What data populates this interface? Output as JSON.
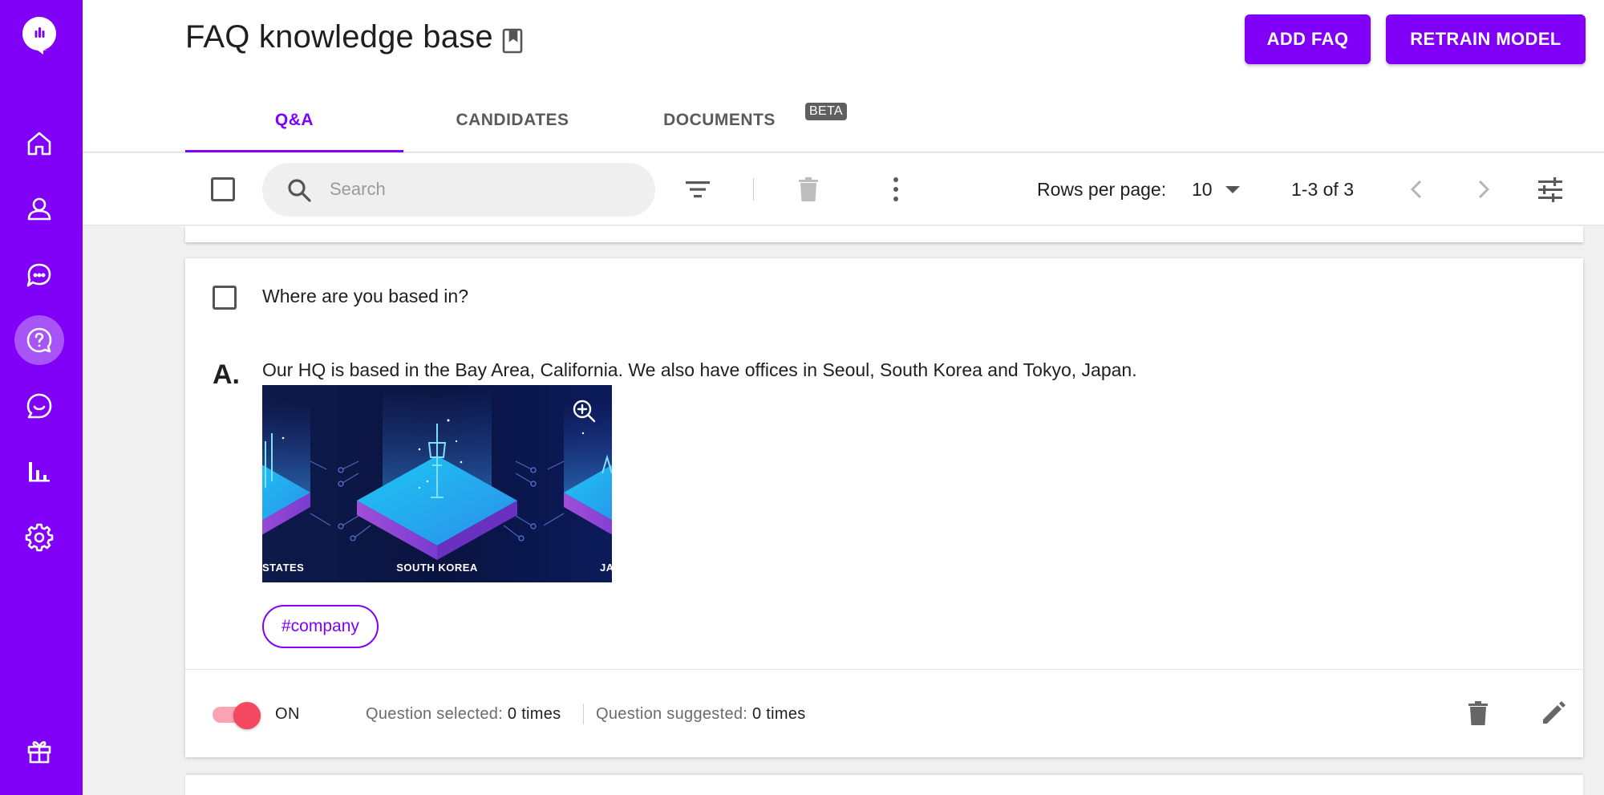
{
  "header": {
    "title": "FAQ knowledge base",
    "add_button": "ADD FAQ",
    "retrain_button": "RETRAIN MODEL"
  },
  "tabs": [
    {
      "label": "Q&A",
      "active": true
    },
    {
      "label": "CANDIDATES",
      "active": false
    },
    {
      "label": "DOCUMENTS",
      "active": false,
      "badge": "BETA"
    }
  ],
  "toolbar": {
    "search_placeholder": "Search",
    "rows_per_page_label": "Rows per page:",
    "rows_per_page_value": "10",
    "page_range": "1-3 of 3"
  },
  "sidebar": {
    "items": [
      "home-icon",
      "user-icon",
      "chat-bubbles-icon",
      "faq-icon",
      "smile-chat-icon",
      "bar-chart-icon",
      "settings-icon",
      "gift-icon"
    ],
    "active_item": "faq-icon"
  },
  "faq": {
    "question": "Where are you based in?",
    "answer_mark": "A.",
    "answer": "Our HQ is based in the Bay Area, California. We also have offices in Seoul, South Korea and Tokyo, Japan.",
    "image_labels": {
      "left": "STATES",
      "center": "SOUTH KOREA",
      "right": "JA"
    },
    "tag": "#company",
    "status": "ON",
    "status_on": true,
    "selected_label": "Question selected:",
    "selected_value": "0 times",
    "suggested_label": "Question suggested:",
    "suggested_value": "0 times"
  },
  "colors": {
    "brand": "#8100f8",
    "toggle_knob": "#f5475f",
    "toggle_track": "#f9a3b3"
  }
}
